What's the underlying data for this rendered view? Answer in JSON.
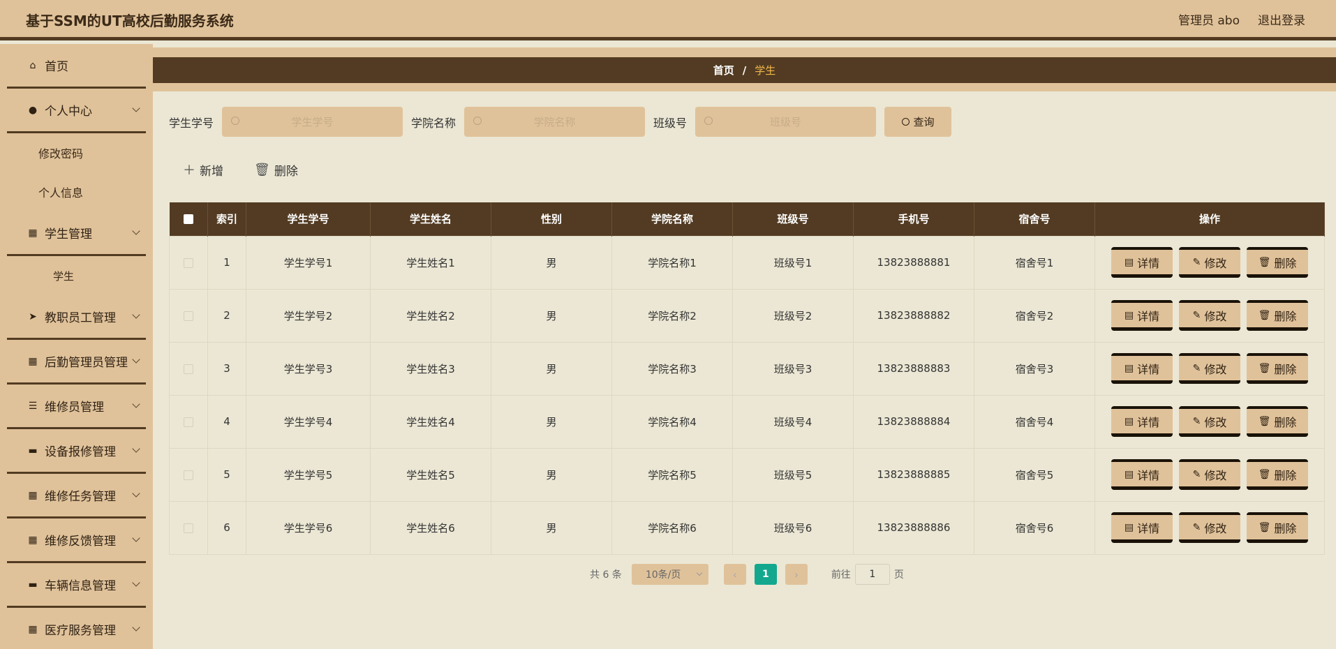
{
  "header": {
    "title": "基于SSM的UT高校后勤服务系统",
    "user": "管理员 abo",
    "logout": "退出登录"
  },
  "sidebar": {
    "items": [
      {
        "label": "首页",
        "icon": "⌂",
        "icon_name": "home-icon",
        "chev": false
      },
      {
        "label": "个人中心",
        "icon": "●",
        "icon_name": "user-icon",
        "chev": true
      },
      {
        "label": "修改密码",
        "sub": true
      },
      {
        "label": "个人信息",
        "sub": true
      },
      {
        "label": "学生管理",
        "icon": "▦",
        "icon_name": "grid-icon",
        "chev": true
      },
      {
        "label": "学生",
        "sub": true,
        "active": true
      },
      {
        "label": "教职员工管理",
        "icon": "➤",
        "icon_name": "send-icon",
        "chev": true
      },
      {
        "label": "后勤管理员管理",
        "icon": "▦",
        "icon_name": "grid-icon",
        "chev": true
      },
      {
        "label": "维修员管理",
        "icon": "☰",
        "icon_name": "sliders-icon",
        "chev": true
      },
      {
        "label": "设备报修管理",
        "icon": "▬",
        "icon_name": "message-icon",
        "chev": true
      },
      {
        "label": "维修任务管理",
        "icon": "▦",
        "icon_name": "grid-icon",
        "chev": true
      },
      {
        "label": "维修反馈管理",
        "icon": "▦",
        "icon_name": "grid-icon",
        "chev": true
      },
      {
        "label": "车辆信息管理",
        "icon": "▬",
        "icon_name": "monitor-icon",
        "chev": true
      },
      {
        "label": "医疗服务管理",
        "icon": "▦",
        "icon_name": "grid-icon",
        "chev": true
      }
    ]
  },
  "breadcrumb": {
    "home": "首页",
    "sep": "/",
    "current": "学生"
  },
  "search": {
    "fields": [
      {
        "label": "学生学号",
        "placeholder": "学生学号"
      },
      {
        "label": "学院名称",
        "placeholder": "学院名称"
      },
      {
        "label": "班级号",
        "placeholder": "班级号"
      }
    ],
    "button": "查询"
  },
  "actions": {
    "add": "新增",
    "delete": "删除"
  },
  "table": {
    "headers": [
      "索引",
      "学生学号",
      "学生姓名",
      "性别",
      "学院名称",
      "班级号",
      "手机号",
      "宿舍号",
      "操作"
    ],
    "rows": [
      [
        "1",
        "学生学号1",
        "学生姓名1",
        "男",
        "学院名称1",
        "班级号1",
        "13823888881",
        "宿舍号1"
      ],
      [
        "2",
        "学生学号2",
        "学生姓名2",
        "男",
        "学院名称2",
        "班级号2",
        "13823888882",
        "宿舍号2"
      ],
      [
        "3",
        "学生学号3",
        "学生姓名3",
        "男",
        "学院名称3",
        "班级号3",
        "13823888883",
        "宿舍号3"
      ],
      [
        "4",
        "学生学号4",
        "学生姓名4",
        "男",
        "学院名称4",
        "班级号4",
        "13823888884",
        "宿舍号4"
      ],
      [
        "5",
        "学生学号5",
        "学生姓名5",
        "男",
        "学院名称5",
        "班级号5",
        "13823888885",
        "宿舍号5"
      ],
      [
        "6",
        "学生学号6",
        "学生姓名6",
        "男",
        "学院名称6",
        "班级号6",
        "13823888886",
        "宿舍号6"
      ]
    ],
    "ops": {
      "detail": "详情",
      "edit": "修改",
      "delete": "删除"
    }
  },
  "pagination": {
    "total": "共 6 条",
    "page_size": "10条/页",
    "current": "1",
    "goto_label": "前往",
    "goto_value": "1",
    "page_suffix": "页"
  },
  "colors": {
    "topbar": "#e0c29a",
    "dark_brown": "#523b22",
    "content_bg": "#ebe7d4",
    "active_page": "#13a88e",
    "breadcrumb_current": "#f2b84a"
  }
}
